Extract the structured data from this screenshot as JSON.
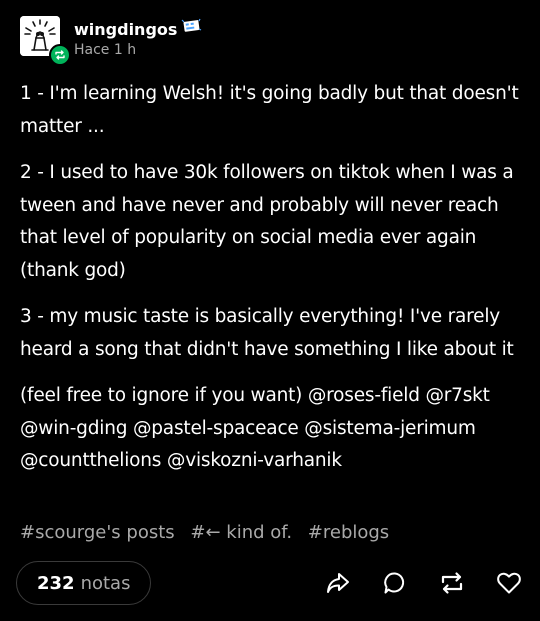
{
  "post": {
    "username": "wingdingos",
    "time": "Hace 1 h",
    "paragraphs": [
      "1 - I'm learning Welsh! it's going badly but that doesn't matter ...",
      "2 - I used to have 30k followers on tiktok when I was a tween and have never and probably will never reach that level of popularity on social media ever again (thank god)",
      "3 - my music taste is basically everything! I've rarely heard a song that didn't have something I like about it"
    ],
    "mentions_intro": "(feel free to ignore if you want)",
    "mentions": [
      "@roses-field",
      "@r7skt",
      "@win-gding",
      "@pastel-spaceace",
      "@sistema-jerimum",
      "@countthelions",
      "@viskozni-varhanik"
    ],
    "tags": [
      "#scourge's posts",
      "#← kind of.",
      "#reblogs"
    ]
  },
  "footer": {
    "notes_count": "232",
    "notes_label": "notas"
  },
  "icons": {
    "reblog_badge": "reblog-icon",
    "user_badge": "badge-icon",
    "share": "share-icon",
    "reply": "reply-icon",
    "reblog": "reblog-icon",
    "like": "heart-icon"
  },
  "colors": {
    "background": "#000000",
    "text": "#ffffff",
    "secondary_text": "#a9a9a9",
    "reblog_badge": "#00b35a",
    "pill_border": "#3a3a3a"
  }
}
